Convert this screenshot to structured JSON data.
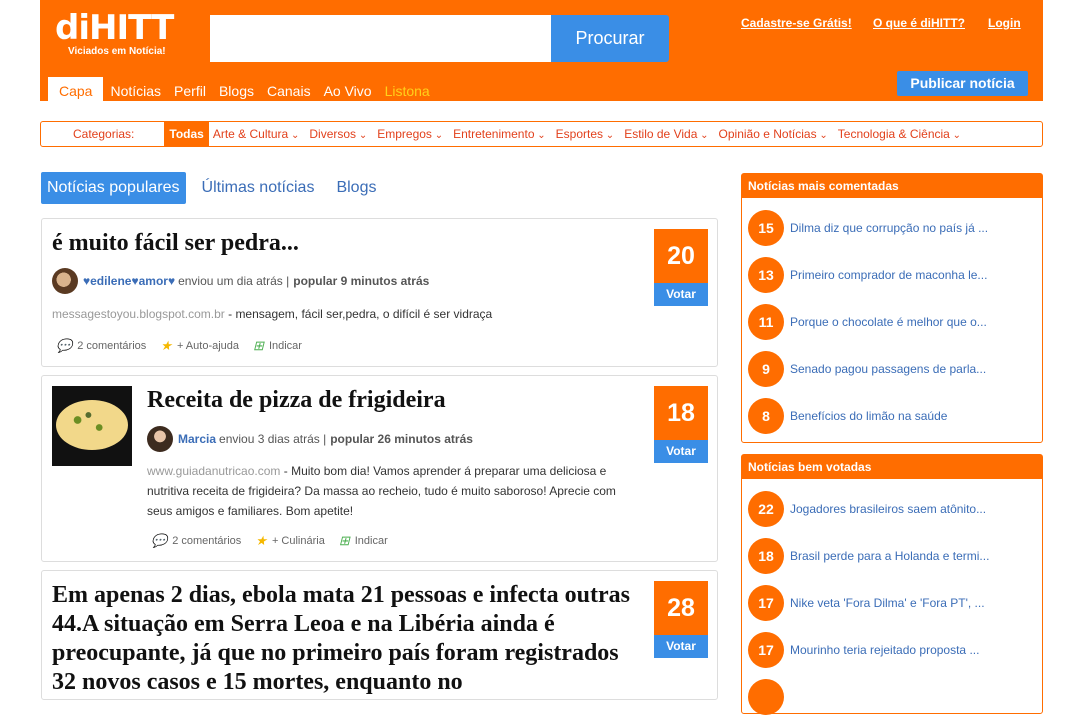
{
  "header": {
    "logo_text": "diHITT",
    "tagline": "Viciados em Notícia!",
    "search_placeholder": "",
    "search_button": "Procurar",
    "links": {
      "signup": "Cadastre-se Grátis!",
      "about": "O que é diHITT?",
      "login": "Login"
    },
    "publish_button": "Publicar notícia",
    "nav": [
      "Capa",
      "Notícias",
      "Perfil",
      "Blogs",
      "Canais",
      "Ao Vivo",
      "Listona"
    ]
  },
  "categories": {
    "label": "Categorias:",
    "all": "Todas",
    "items": [
      "Arte & Cultura",
      "Diversos",
      "Empregos",
      "Entretenimento",
      "Esportes",
      "Estilo de Vida",
      "Opinião e Notícias",
      "Tecnologia & Ciência"
    ]
  },
  "tabs": [
    "Notícias populares",
    "Últimas notícias",
    "Blogs"
  ],
  "posts": [
    {
      "title": "é muito fácil ser pedra...",
      "votes": "20",
      "vote_label": "Votar",
      "user": "♥edilene♥amor♥",
      "meta_plain": "enviou um dia atrás |",
      "meta_bold": "popular 9 minutos atrás",
      "source": "messagestoyou.blogspot.com.br",
      "snippet": "- mensagem, fácil ser,pedra, o difícil é ser vidraça",
      "comments": "2 comentários",
      "category": "+ Auto-ajuda",
      "indicate": "Indicar"
    },
    {
      "title": "Receita de pizza de frigideira",
      "votes": "18",
      "vote_label": "Votar",
      "user": "Marcia",
      "meta_plain": "enviou 3 dias atrás |",
      "meta_bold": "popular 26 minutos atrás",
      "source": "www.guiadanutricao.com",
      "snippet": "- Muito bom dia! Vamos aprender á preparar uma deliciosa e nutritiva receita de frigideira? Da massa ao recheio, tudo é muito saboroso! Aprecie com seus amigos e familiares. Bom apetite!",
      "comments": "2 comentários",
      "category": "+ Culinária",
      "indicate": "Indicar"
    },
    {
      "title": "Em apenas 2 dias, ebola mata 21 pessoas e infecta outras 44.A situação em Serra Leoa e na Libéria ainda é preocupante, já que no primeiro país foram registrados 32 novos casos e 15 mortes, enquanto no",
      "votes": "28",
      "vote_label": "Votar"
    }
  ],
  "sidebar": {
    "most_commented": {
      "title": "Notícias mais comentadas",
      "items": [
        {
          "n": "15",
          "t": "Dilma diz que corrupção no país já ..."
        },
        {
          "n": "13",
          "t": "Primeiro comprador de maconha le..."
        },
        {
          "n": "11",
          "t": "Porque o chocolate é melhor que o..."
        },
        {
          "n": "9",
          "t": "Senado pagou passagens de parla..."
        },
        {
          "n": "8",
          "t": "Benefícios do limão na saúde"
        }
      ]
    },
    "best_voted": {
      "title": "Notícias bem votadas",
      "items": [
        {
          "n": "22",
          "t": "Jogadores brasileiros saem atônito..."
        },
        {
          "n": "18",
          "t": "Brasil perde para a Holanda e termi..."
        },
        {
          "n": "17",
          "t": "Nike veta 'Fora Dilma' e 'Fora PT', ..."
        },
        {
          "n": "17",
          "t": "Mourinho teria rejeitado proposta ..."
        }
      ]
    }
  },
  "colors": {
    "brand": "#ff6d00",
    "accent": "#3a8ee6",
    "link": "#3b6db7"
  }
}
